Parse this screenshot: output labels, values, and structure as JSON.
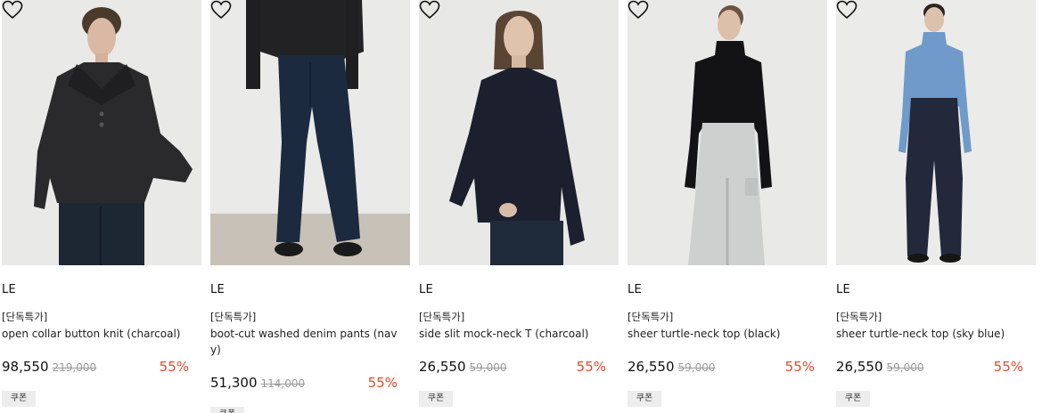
{
  "products": [
    {
      "brand": "LE",
      "tag": "[단독특가]",
      "name": "open collar button knit (charcoal)",
      "price": "98,550",
      "original_price": "219,000",
      "discount": "55%",
      "coupon": "쿠폰",
      "wishlist_icon": "heart-outline-icon"
    },
    {
      "brand": "LE",
      "tag": "[단독특가]",
      "name": "boot-cut washed denim pants (navy)",
      "price": "51,300",
      "original_price": "114,000",
      "discount": "55%",
      "coupon": "쿠폰",
      "wishlist_icon": "heart-outline-icon"
    },
    {
      "brand": "LE",
      "tag": "[단독특가]",
      "name": "side slit mock-neck T (charcoal)",
      "price": "26,550",
      "original_price": "59,000",
      "discount": "55%",
      "coupon": "쿠폰",
      "wishlist_icon": "heart-outline-icon"
    },
    {
      "brand": "LE",
      "tag": "[단독특가]",
      "name": "sheer turtle-neck top (black)",
      "price": "26,550",
      "original_price": "59,000",
      "discount": "55%",
      "coupon": "쿠폰",
      "wishlist_icon": "heart-outline-icon"
    },
    {
      "brand": "LE",
      "tag": "[단독특가]",
      "name": "sheer turtle-neck top (sky blue)",
      "price": "26,550",
      "original_price": "59,000",
      "discount": "55%",
      "coupon": "쿠폰",
      "wishlist_icon": "heart-outline-icon"
    }
  ],
  "colors": {
    "discount": "#e8482f",
    "original_price": "#9a9a9a",
    "coupon_bg": "#ededed",
    "photo_bg": "#e9e9e7"
  }
}
